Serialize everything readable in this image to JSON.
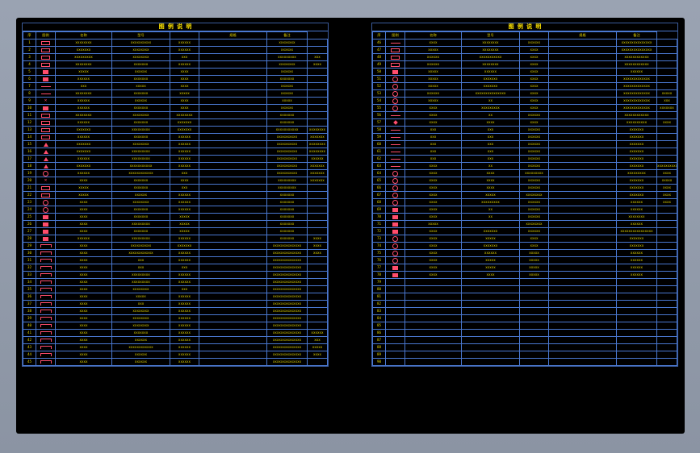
{
  "sheets": [
    {
      "title": "图 例 说 明",
      "headers": [
        "序",
        "图例",
        "名称",
        "型号",
        "规格",
        "备注"
      ],
      "rows": [
        {
          "no": "1",
          "sym": "rect",
          "c": [
            "xxxxxxxx",
            "xxxxxxxxxx",
            "xxxxxx",
            "xxxxxxxx",
            ""
          ]
        },
        {
          "no": "2",
          "sym": "rect",
          "c": [
            "xxxxxxx",
            "xxxxxxxx",
            "xxxxxx",
            "xxxxxx",
            ""
          ]
        },
        {
          "no": "3",
          "sym": "rect",
          "c": [
            "xxxxxxxxx",
            "xxxxxxxx",
            "xxx",
            "xxxxxxxxx",
            "xxx"
          ]
        },
        {
          "no": "4",
          "sym": "rect",
          "c": [
            "xxxxxxxx",
            "xxxxxxx",
            "xxxxxx",
            "xxxxxxxx",
            "xxxx"
          ]
        },
        {
          "no": "5",
          "sym": "box",
          "c": [
            "xxxxx",
            "xxxxxx",
            "xxxx",
            "xxxxxx",
            ""
          ]
        },
        {
          "no": "6",
          "sym": "box",
          "c": [
            "xxxxxx",
            "xxxxxxx",
            "xxxx",
            "xxxxxxx",
            ""
          ]
        },
        {
          "no": "7",
          "sym": "line",
          "c": [
            "xxx",
            "xxxxx",
            "xxxx",
            "xxxxxx",
            ""
          ]
        },
        {
          "no": "8",
          "sym": "line",
          "c": [
            "xxxxxxxx",
            "xxxxxxx",
            "xxxxx",
            "xxxxxx",
            ""
          ]
        },
        {
          "no": "9",
          "sym": "cross",
          "c": [
            "xxxxxx",
            "xxxxxx",
            "xxxx",
            "xxxxx",
            ""
          ]
        },
        {
          "no": "10",
          "sym": "box",
          "c": [
            "xxxxxx",
            "xxxxxxx",
            "xxxx",
            "xxxxxx",
            ""
          ]
        },
        {
          "no": "11",
          "sym": "rect",
          "c": [
            "xxxxxxxx",
            "xxxxxxxx",
            "xxxxxxxx",
            "xxxxxxx",
            ""
          ]
        },
        {
          "no": "12",
          "sym": "rect",
          "c": [
            "xxxxxx",
            "xxxxxxx",
            "xxxxxxx",
            "xxxxxxx",
            ""
          ]
        },
        {
          "no": "13",
          "sym": "rect",
          "c": [
            "xxxxxxx",
            "xxxxxxxxx",
            "xxxxxxx",
            "xxxxxxxxxxx",
            "xxxxxxxx"
          ]
        },
        {
          "no": "14",
          "sym": "rect",
          "c": [
            "xxxxxx",
            "xxxxxxx",
            "xxxxxx",
            "xxxxxxxxxx",
            "xxxxxxx"
          ]
        },
        {
          "no": "15",
          "sym": "tri",
          "c": [
            "xxxxxxx",
            "xxxxxxxx",
            "xxxxxx",
            "xxxxxxxxxx",
            "xxxxxxxx"
          ]
        },
        {
          "no": "16",
          "sym": "tri",
          "c": [
            "xxxxxxx",
            "xxxxxxxxx",
            "xxxxxx",
            "xxxxxxxxxx",
            "xxxxxxxx"
          ]
        },
        {
          "no": "17",
          "sym": "tri",
          "c": [
            "xxxxxx",
            "xxxxxxxxx",
            "xxxxxx",
            "xxxxxxxxxx",
            "xxxxxx"
          ]
        },
        {
          "no": "18",
          "sym": "tri",
          "c": [
            "xxxxxxx",
            "xxxxxxxxxxx",
            "xxxxxx",
            "xxxxxxxxxx",
            "xxxxxxx"
          ]
        },
        {
          "no": "19",
          "sym": "circ",
          "c": [
            "xxxxxx",
            "xxxxxxxxxxxx",
            "xxx",
            "xxxxxxxxxx",
            "xxxxxxx"
          ]
        },
        {
          "no": "20",
          "sym": "cross",
          "c": [
            "xxxx",
            "xxxxxxx",
            "xxxx",
            "xxxxxxxxx",
            "xxxxxxx"
          ]
        },
        {
          "no": "21",
          "sym": "rect",
          "c": [
            "xxxxx",
            "xxxxxxx",
            "xxx",
            "xxxxxxxxx",
            ""
          ]
        },
        {
          "no": "22",
          "sym": "rect",
          "c": [
            "xxxxx",
            "xxxxxx",
            "xxxxxx",
            "xxxxxxx",
            ""
          ]
        },
        {
          "no": "23",
          "sym": "circ",
          "c": [
            "xxxx",
            "xxxxxxxx",
            "xxxxxx",
            "xxxxxxx",
            ""
          ]
        },
        {
          "no": "24",
          "sym": "circ",
          "c": [
            "xxxx",
            "xxxxxxx",
            "xxxxxx",
            "xxxxxxx",
            ""
          ]
        },
        {
          "no": "25",
          "sym": "box",
          "c": [
            "xxxx",
            "xxxxxxx",
            "xxxxx",
            "xxxxxxx",
            ""
          ]
        },
        {
          "no": "26",
          "sym": "box",
          "c": [
            "xxxx",
            "xxxxxxxxx",
            "xxxxx",
            "xxxxxxx",
            ""
          ]
        },
        {
          "no": "27",
          "sym": "box",
          "c": [
            "xxxx",
            "xxxxxxx",
            "xxxxx",
            "xxxxxxx",
            ""
          ]
        },
        {
          "no": "28",
          "sym": "box",
          "c": [
            "xxxxxx",
            "xxxxxxxxx",
            "xxxxxx",
            "xxxxxxx",
            "xxxx"
          ]
        },
        {
          "no": "29",
          "sym": "step",
          "c": [
            "xxxx",
            "xxxxxxxxxx",
            "xxxxxxx",
            "xxxxxxxxxxxxxx",
            "xxxx"
          ]
        },
        {
          "no": "30",
          "sym": "step",
          "c": [
            "xxxx",
            "xxxxxxxxxxxx",
            "xxxxxx",
            "xxxxxxxxxxxxxx",
            "xxxx"
          ]
        },
        {
          "no": "31",
          "sym": "step",
          "c": [
            "xxxx",
            "xxx",
            "xxxxxx",
            "xxxxxxxxxxxxxx",
            ""
          ]
        },
        {
          "no": "32",
          "sym": "step",
          "c": [
            "xxxx",
            "xxx",
            "xxx",
            "xxxxxxxxxxxxxx",
            ""
          ]
        },
        {
          "no": "33",
          "sym": "step",
          "c": [
            "xxxx",
            "xxxxxxxxx",
            "xxxxxx",
            "xxxxxxxxxxxxxx",
            ""
          ]
        },
        {
          "no": "34",
          "sym": "step",
          "c": [
            "xxxx",
            "xxxxxxxxx",
            "xxxxxx",
            "xxxxxxxxxxxxxx",
            ""
          ]
        },
        {
          "no": "35",
          "sym": "step",
          "c": [
            "xxxx",
            "xxxxxxxx",
            "xxx",
            "xxxxxxxxxxxxxx",
            ""
          ]
        },
        {
          "no": "36",
          "sym": "step",
          "c": [
            "xxxx",
            "xxxxx",
            "xxxxxx",
            "xxxxxxxxxxxxxx",
            ""
          ]
        },
        {
          "no": "37",
          "sym": "step",
          "c": [
            "xxxx",
            "xxx",
            "xxxxxx",
            "xxxxxxxxxxxxxx",
            ""
          ]
        },
        {
          "no": "38",
          "sym": "step",
          "c": [
            "xxxx",
            "xxxxxxxx",
            "xxxxxx",
            "xxxxxxxxxxxxxx",
            ""
          ]
        },
        {
          "no": "39",
          "sym": "step",
          "c": [
            "xxxx",
            "xxxxxxxx",
            "xxxxxx",
            "xxxxxxxxxxxxxx",
            ""
          ]
        },
        {
          "no": "40",
          "sym": "step",
          "c": [
            "xxxx",
            "xxxxxxxx",
            "xxxxxx",
            "xxxxxxxxxxxxxx",
            ""
          ]
        },
        {
          "no": "41",
          "sym": "step",
          "c": [
            "xxxx",
            "xxxxxxx",
            "xxxxxx",
            "xxxxxxxxxxxxxx",
            "xxxxxx"
          ]
        },
        {
          "no": "42",
          "sym": "step",
          "c": [
            "xxxx",
            "xxxxxx",
            "xxxxxx",
            "xxxxxxxxxxxxxx",
            "xxx"
          ]
        },
        {
          "no": "43",
          "sym": "step",
          "c": [
            "xxxx",
            "xxxxxxxxxxxx",
            "xxxxxx",
            "xxxxxxxxxxxxxx",
            "xxxxx"
          ]
        },
        {
          "no": "44",
          "sym": "step",
          "c": [
            "xxxx",
            "xxxxxx",
            "xxxxxx",
            "xxxxxxxxxxxxxx",
            "xxxx"
          ]
        },
        {
          "no": "45",
          "sym": "step",
          "c": [
            "xxxx",
            "xxxxxx",
            "xxxxxx",
            "xxxxxxxxxxxxxx",
            ""
          ]
        }
      ]
    },
    {
      "title": "图 例 说 明",
      "headers": [
        "序",
        "图例",
        "名称",
        "型号",
        "规格",
        "备注"
      ],
      "rows": [
        {
          "no": "46",
          "sym": "line",
          "c": [
            "xxxx",
            "xxxxxxxx",
            "xxxxxx",
            "xxxxxxxxxxxxxxx",
            ""
          ]
        },
        {
          "no": "47",
          "sym": "rect",
          "c": [
            "xxxxx",
            "xxxxxxxx",
            "xxxx",
            "xxxxxxxxxxxxxxx",
            ""
          ]
        },
        {
          "no": "48",
          "sym": "rect",
          "c": [
            "xxxxxx",
            "xxxxxxxxxxx",
            "xxxx",
            "xxxxxxxxxxxx",
            ""
          ]
        },
        {
          "no": "49",
          "sym": "rect",
          "c": [
            "xxxxxx",
            "xxxxxxxx",
            "xxxx",
            "xxxxxxxxxxxx",
            ""
          ]
        },
        {
          "no": "50",
          "sym": "box",
          "c": [
            "xxxxx",
            "xxxxxx",
            "xxxx",
            "xxxxxx",
            ""
          ]
        },
        {
          "no": "51",
          "sym": "circ",
          "c": [
            "xxxxx",
            "xxxxxxx",
            "xxxx",
            "xxxxxxxxxxxxx",
            ""
          ]
        },
        {
          "no": "52",
          "sym": "circ",
          "c": [
            "xxxxx",
            "xxxxxxx",
            "xxxx",
            "xxxxxxxxxxxxx",
            ""
          ]
        },
        {
          "no": "53",
          "sym": "circ",
          "c": [
            "xxxxxx",
            "xxxxxxxxxxxxxxx",
            "xxxx",
            "xxxxxxxxxxxxx",
            "xxxxx"
          ]
        },
        {
          "no": "54",
          "sym": "circ",
          "c": [
            "xxxxx",
            "xx",
            "xxxx",
            "xxxxxxxxxxxxx",
            "xxx"
          ]
        },
        {
          "no": "55",
          "sym": "circ",
          "c": [
            "xxxx",
            "xxxxxxxxx",
            "xxxx",
            "xxxxxxxxxxxxx",
            "xxxxxxx"
          ]
        },
        {
          "no": "56",
          "sym": "line",
          "c": [
            "xxxx",
            "xx",
            "xxxxxx",
            "xxxxxxxxxxxx",
            ""
          ]
        },
        {
          "no": "57",
          "sym": "diamond",
          "c": [
            "xxxx",
            "xxxx",
            "xxxx",
            "xxxxxxxxxx",
            "xxxx"
          ]
        },
        {
          "no": "58",
          "sym": "line",
          "c": [
            "xxx",
            "xxx",
            "xxxxxx",
            "xxxxxxx",
            ""
          ]
        },
        {
          "no": "59",
          "sym": "line",
          "c": [
            "xxx",
            "xxx",
            "xxxxxx",
            "xxxxxxx",
            ""
          ]
        },
        {
          "no": "60",
          "sym": "line",
          "c": [
            "xxx",
            "xxx",
            "xxxxxx",
            "xxxxxxx",
            ""
          ]
        },
        {
          "no": "61",
          "sym": "line",
          "c": [
            "xxx",
            "xxx",
            "xxxxxx",
            "xxxxxxx",
            ""
          ]
        },
        {
          "no": "62",
          "sym": "line",
          "c": [
            "xxx",
            "xxx",
            "xxxxxx",
            "xxxxxxx",
            ""
          ]
        },
        {
          "no": "63",
          "sym": "line",
          "c": [
            "xxxx",
            "xx",
            "xxxxxx",
            "xxxxxxx",
            "xxxxxxxxxx"
          ]
        },
        {
          "no": "64",
          "sym": "circ",
          "c": [
            "xxxx",
            "xxxx",
            "xxxxxxxxx",
            "xxxxxxxxx",
            "xxxx"
          ]
        },
        {
          "no": "65",
          "sym": "circ",
          "c": [
            "xxxx",
            "xxxx",
            "xxxxxx",
            "xxxxxxx",
            "xxxxx"
          ]
        },
        {
          "no": "66",
          "sym": "circ",
          "c": [
            "xxxx",
            "xxxx",
            "xxxxxx",
            "xxxxxxx",
            "xxxx"
          ]
        },
        {
          "no": "67",
          "sym": "circ",
          "c": [
            "xxxx",
            "xxxxx",
            "xxxxxxxx",
            "xxxxxxx",
            "xxxx"
          ]
        },
        {
          "no": "68",
          "sym": "circ",
          "c": [
            "xxxx",
            "xxxxxxxxx",
            "xxxxxx",
            "xxxxxx",
            "xxxx"
          ]
        },
        {
          "no": "69",
          "sym": "box",
          "c": [
            "xxxx",
            "xx",
            "xxxxxx",
            "xxxxxx",
            ""
          ]
        },
        {
          "no": "70",
          "sym": "box",
          "c": [
            "xxxx",
            "xx",
            "xxxxxx",
            "xxxxxxxx",
            ""
          ]
        },
        {
          "no": "71",
          "sym": "box",
          "c": [
            "xxxxx",
            "",
            "xxxxxxxx",
            "xxxxxx",
            ""
          ]
        },
        {
          "no": "72",
          "sym": "box",
          "c": [
            "xxxx",
            "xxxxxxx",
            "xxxxxx",
            "xxxxxxxxxxxxxxxx",
            ""
          ]
        },
        {
          "no": "73",
          "sym": "circ",
          "c": [
            "xxxx",
            "xxxxx",
            "xxxx",
            "xxxxxxx",
            ""
          ]
        },
        {
          "no": "74",
          "sym": "circ",
          "c": [
            "xxxx",
            "xxxxxxx",
            "xxxx",
            "xxxxxxx",
            ""
          ]
        },
        {
          "no": "75",
          "sym": "circ",
          "c": [
            "xxxx",
            "xxxxxx",
            "xxxxx",
            "xxxxxx",
            ""
          ]
        },
        {
          "no": "76",
          "sym": "circ",
          "c": [
            "xxxx",
            "xxxxx",
            "xxxxx",
            "xxxxxx",
            ""
          ]
        },
        {
          "no": "77",
          "sym": "box",
          "c": [
            "xxxx",
            "xxxxx",
            "xxxxx",
            "xxxxxx",
            ""
          ]
        },
        {
          "no": "78",
          "sym": "box",
          "c": [
            "xxxx",
            "xxxx",
            "xxxxx",
            "xxxxxx",
            ""
          ]
        },
        {
          "no": "79",
          "sym": "",
          "c": [
            "",
            "",
            "",
            "",
            ""
          ]
        },
        {
          "no": "80",
          "sym": "",
          "c": [
            "",
            "",
            "",
            "",
            ""
          ]
        },
        {
          "no": "81",
          "sym": "",
          "c": [
            "",
            "",
            "",
            "",
            ""
          ]
        },
        {
          "no": "82",
          "sym": "",
          "c": [
            "",
            "",
            "",
            "",
            ""
          ]
        },
        {
          "no": "83",
          "sym": "",
          "c": [
            "",
            "",
            "",
            "",
            ""
          ]
        },
        {
          "no": "84",
          "sym": "",
          "c": [
            "",
            "",
            "",
            "",
            ""
          ]
        },
        {
          "no": "85",
          "sym": "",
          "c": [
            "",
            "",
            "",
            "",
            ""
          ]
        },
        {
          "no": "86",
          "sym": "",
          "c": [
            "",
            "",
            "",
            "",
            ""
          ]
        },
        {
          "no": "87",
          "sym": "",
          "c": [
            "",
            "",
            "",
            "",
            ""
          ]
        },
        {
          "no": "88",
          "sym": "",
          "c": [
            "",
            "",
            "",
            "",
            ""
          ]
        },
        {
          "no": "89",
          "sym": "",
          "c": [
            "",
            "",
            "",
            "",
            ""
          ]
        },
        {
          "no": "90",
          "sym": "",
          "c": [
            "",
            "",
            "",
            "",
            ""
          ]
        }
      ]
    }
  ],
  "colors": {
    "grid": "#4a78d0",
    "text": "#e6d800",
    "symbol": "#ff4d6d",
    "sheet_bg": "#000000"
  }
}
